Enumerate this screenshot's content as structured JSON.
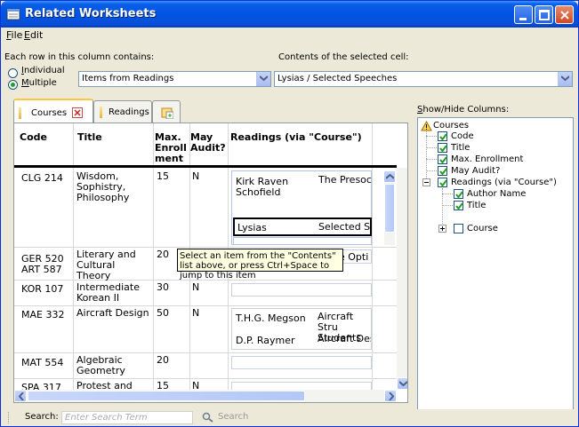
{
  "window": {
    "title": "Related Worksheets"
  },
  "menu": [
    {
      "key": "F",
      "rest": "ile"
    },
    {
      "key": "E",
      "rest": "dit"
    }
  ],
  "row_contains": {
    "label": "Each row in this column contains:",
    "options": [
      {
        "key": "I",
        "rest": "ndividual",
        "selected": false
      },
      {
        "key": "M",
        "rest": "ultiple",
        "selected": true
      }
    ],
    "combo_value": "Items from Readings"
  },
  "contents": {
    "label": "Contents of the selected cell:",
    "combo_value": "Lysias / Selected Speeches"
  },
  "tabs": [
    {
      "label": "Courses",
      "active": true
    },
    {
      "label": "Readings",
      "active": false
    }
  ],
  "grid": {
    "headers": [
      "Code",
      "Title",
      "Max. Enroll ment",
      "May Audit?",
      "Readings (via \"Course\")"
    ],
    "rows": [
      {
        "code": "CLG 214",
        "title": "Wisdom, Sophistry, Philosophy",
        "max": "15",
        "audit": "N",
        "readings": [
          {
            "author": "Kirk Raven Schofield",
            "title": "The Presoc"
          },
          {
            "author": "Lysias",
            "title": "Selected S"
          }
        ]
      },
      {
        "code": "GER 520 ART 587",
        "title": "Literary and Cultural Theory",
        "max": "20",
        "audit": "",
        "readings_partial": "e Opti"
      },
      {
        "code": "KOR 107",
        "title": "Intermediate Korean II",
        "max": "30",
        "audit": "N"
      },
      {
        "code": "MAE 332",
        "title": "Aircraft Design",
        "max": "50",
        "audit": "N",
        "readings": [
          {
            "author": "T.H.G. Megson",
            "title": "Aircraft Stru Students"
          },
          {
            "author": "D.P. Raymer",
            "title": "Aircraft Des"
          }
        ]
      },
      {
        "code": "MAT 554",
        "title": "Algebraic Geometry",
        "max": "20",
        "audit": ""
      },
      {
        "code": "SPA 317",
        "title": "Protest and",
        "max": "15",
        "audit": "N"
      }
    ]
  },
  "tooltip": "Select an item from the \"Contents\" list above, or press Ctrl+Space to jump to this item",
  "show_hide": {
    "label_key": "S",
    "label_rest": "how/Hide Columns:",
    "root": "Courses",
    "items": [
      {
        "label": "Code",
        "checked": true
      },
      {
        "label": "Title",
        "checked": true
      },
      {
        "label": "Max. Enrollment",
        "checked": true
      },
      {
        "label": "May Audit?",
        "checked": true
      },
      {
        "label": "Readings (via \"Course\")",
        "checked": true
      },
      {
        "label": "Author Name",
        "checked": true
      },
      {
        "label": "Title",
        "checked": true
      },
      {
        "label": "Course",
        "checked": false
      }
    ]
  },
  "status": {
    "search_label": "Search:",
    "search_placeholder": "Enter Search Term",
    "search_button": "Search"
  }
}
